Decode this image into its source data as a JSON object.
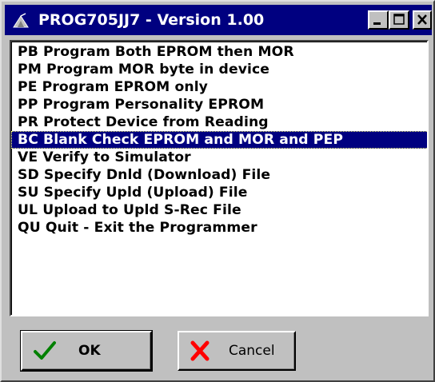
{
  "window": {
    "title": "PROG705JJ7 - Version 1.00",
    "app_icon": "programmer-app-icon",
    "caption_buttons": [
      "minimize-icon",
      "maximize-icon",
      "close-icon"
    ]
  },
  "commands": {
    "selected_index": 5,
    "items": [
      {
        "label": "PB Program Both EPROM then MOR"
      },
      {
        "label": "PM Program MOR byte in device"
      },
      {
        "label": "PE Program EPROM only"
      },
      {
        "label": "PP Program Personality EPROM"
      },
      {
        "label": "PR Protect Device from Reading"
      },
      {
        "label": "BC Blank Check EPROM and MOR and PEP"
      },
      {
        "label": "VE Verify to Simulator"
      },
      {
        "label": "SD Specify Dnld (Download) File"
      },
      {
        "label": "SU Specify Upld (Upload) File"
      },
      {
        "label": "UL Upload to Upld S-Rec File"
      },
      {
        "label": "QU Quit - Exit the Programmer"
      }
    ]
  },
  "buttons": {
    "ok_label": "OK",
    "ok_icon": "checkmark-icon",
    "cancel_label": "Cancel",
    "cancel_icon": "x-cross-icon"
  },
  "colors": {
    "titlebar": "#000080",
    "selection": "#000080",
    "face": "#c0c0c0",
    "ok_check": "#008000",
    "cancel_x": "#ff0000"
  }
}
